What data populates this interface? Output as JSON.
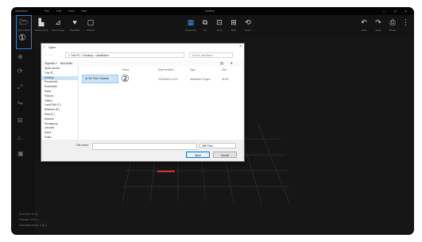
{
  "titlebar": {
    "app_name": "ideaMaker",
    "menus": [
      "File",
      "Edit",
      "View",
      "Help"
    ],
    "filename": "Untitled",
    "window_controls": [
      "–",
      "□",
      "×"
    ]
  },
  "toolbar": {
    "left": [
      {
        "icon": "folder-open-icon",
        "label": "Import Model"
      },
      {
        "icon": "library-icon",
        "label": "Model Library"
      },
      {
        "icon": "auto-arrange-icon",
        "label": "Auto Arrange"
      },
      {
        "icon": "clear-icon",
        "label": "Clear Bed"
      },
      {
        "icon": "preview-icon",
        "label": "Preview"
      }
    ],
    "center": [
      {
        "icon": "perspective-icon",
        "label": "Perspective"
      },
      {
        "icon": "top-view-icon",
        "label": "Top"
      },
      {
        "icon": "front-view-icon",
        "label": "Front"
      },
      {
        "icon": "right-view-icon",
        "label": "Right"
      },
      {
        "icon": "reset-view-icon",
        "label": "Reset"
      }
    ],
    "right": [
      {
        "icon": "undo-icon",
        "label": "Undo"
      },
      {
        "icon": "redo-icon",
        "label": "Redo"
      },
      {
        "icon": "printer-icon",
        "label": "Printer"
      }
    ]
  },
  "markers": {
    "one": "①",
    "two": "②"
  },
  "dialog": {
    "title": "Open",
    "close": "×",
    "nav_arrows": "← → ↑",
    "address": "> This PC > Desktop > ideaMaker",
    "search_placeholder": "Search ideaMaker",
    "command_bar": [
      "Organize ▾",
      "New folder"
    ],
    "nav_items": [
      "Quick access",
      "This PC",
      "Desktop",
      "Documents",
      "Downloads",
      "Music",
      "Pictures",
      "Videos",
      "Local Disk (C:)",
      "Windows (D:)",
      "Data (E:)",
      "Network",
      "Homegroup",
      "Libraries",
      "Users",
      "Public"
    ],
    "columns": [
      "Name",
      "Date modified",
      "Type",
      "Size"
    ],
    "file": {
      "name": "3D Part Tutorial",
      "date": "2019/06/04 10:22",
      "type": "ideaMaker Project",
      "size": "56 KB"
    },
    "filename_label": "File name:",
    "filetype": "3MF Files",
    "open_button": "Open",
    "cancel_button": "Cancel"
  },
  "status": {
    "line1": "Print time: 0h 0m",
    "line2": "Filament: 0.00 m",
    "line3": "Estimated weight: 0.00 g"
  }
}
